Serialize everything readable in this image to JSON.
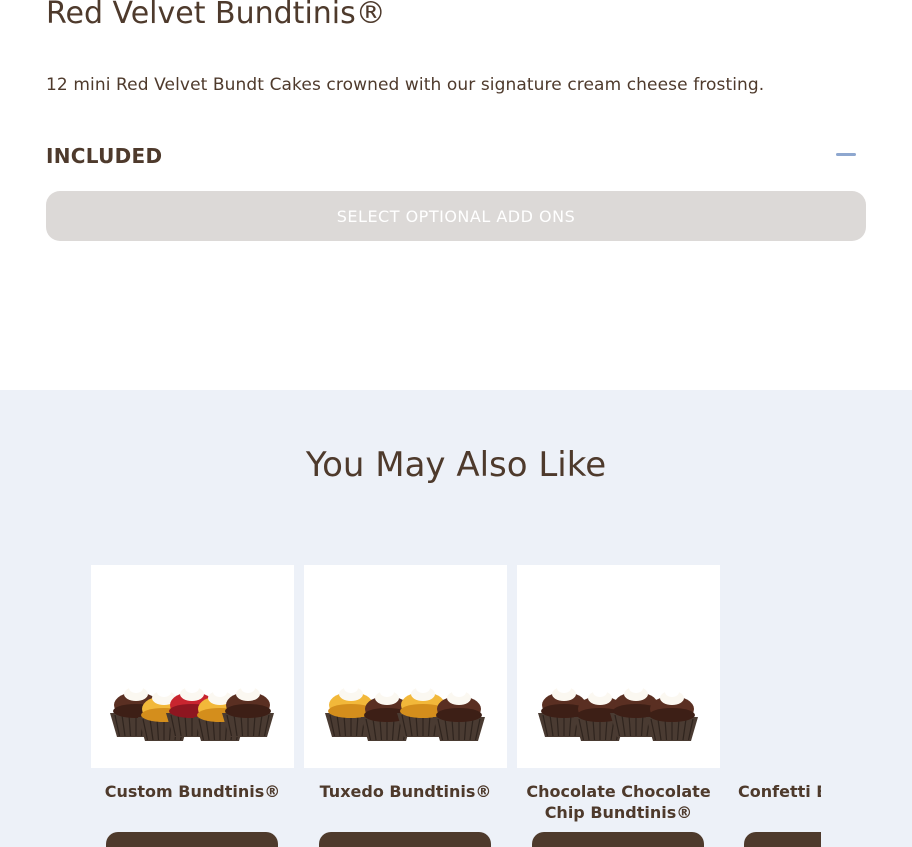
{
  "product": {
    "title": "Red Velvet Bundtinis®",
    "description": "12 mini Red Velvet Bundt Cakes crowned with our signature cream cheese frosting.",
    "included_label": "INCLUDED",
    "addons_button_label": "SELECT OPTIONAL ADD ONS"
  },
  "related": {
    "heading": "You May Also Like",
    "items": [
      {
        "name": "Custom Bundtinis®",
        "cakes": [
          "chocolate",
          "yellow",
          "red",
          "yellow",
          "chocolate"
        ]
      },
      {
        "name": "Tuxedo Bundtinis®",
        "cakes": [
          "yellow",
          "chocolate",
          "yellow",
          "chocolate"
        ]
      },
      {
        "name": "Chocolate Chocolate Chip Bundtinis®",
        "cakes": [
          "chocolate",
          "chocolate",
          "chocolate",
          "chocolate"
        ]
      },
      {
        "name": "Confetti Bundtinis®",
        "cakes": []
      }
    ]
  },
  "colors": {
    "brand_brown": "#4e3a2c",
    "related_background": "#edf1f8",
    "addons_disabled": "#dcd9d7",
    "collapse_accent": "#8ea7cf"
  }
}
